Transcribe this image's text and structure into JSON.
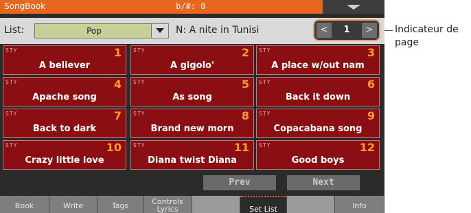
{
  "titlebar": {
    "app": "SongBook",
    "transpose": "b/#: 0"
  },
  "list": {
    "label": "List:",
    "selected": "Pop",
    "name_prefix": "N: ",
    "name": "A nite in Tunisi"
  },
  "pager": {
    "prev": "<",
    "page": "1",
    "next": ">"
  },
  "tiles": [
    {
      "sty": "STY",
      "num": "1",
      "title": "A believer"
    },
    {
      "sty": "STY",
      "num": "2",
      "title": "A gigolo'"
    },
    {
      "sty": "STY",
      "num": "3",
      "title": "A place w/out nam"
    },
    {
      "sty": "STY",
      "num": "4",
      "title": "Apache song"
    },
    {
      "sty": "STY",
      "num": "5",
      "title": "As song"
    },
    {
      "sty": "STY",
      "num": "6",
      "title": "Back it down"
    },
    {
      "sty": "STY",
      "num": "7",
      "title": "Back to dark"
    },
    {
      "sty": "STY",
      "num": "8",
      "title": "Brand new morn"
    },
    {
      "sty": "STY",
      "num": "9",
      "title": "Copacabana song"
    },
    {
      "sty": "STY",
      "num": "10",
      "title": "Crazy little love"
    },
    {
      "sty": "STY",
      "num": "11",
      "title": "Diana twist Diana"
    },
    {
      "sty": "STY",
      "num": "12",
      "title": "Good boys"
    }
  ],
  "nav": {
    "prev": "Prev",
    "next": "Next"
  },
  "tabs": [
    {
      "label": "Book"
    },
    {
      "label": "Write"
    },
    {
      "label": "Tags"
    },
    {
      "label": "Controls Lyrics"
    },
    {
      "label": ""
    },
    {
      "label": "Set List"
    },
    {
      "label": ""
    },
    {
      "label": "Info"
    }
  ],
  "annotation": "Indicateur de page",
  "colors": {
    "accent": "#e8671f",
    "tile": "#8b0f12",
    "tile_number": "#ff9a2a",
    "pager_highlight": "#f1a06c"
  }
}
